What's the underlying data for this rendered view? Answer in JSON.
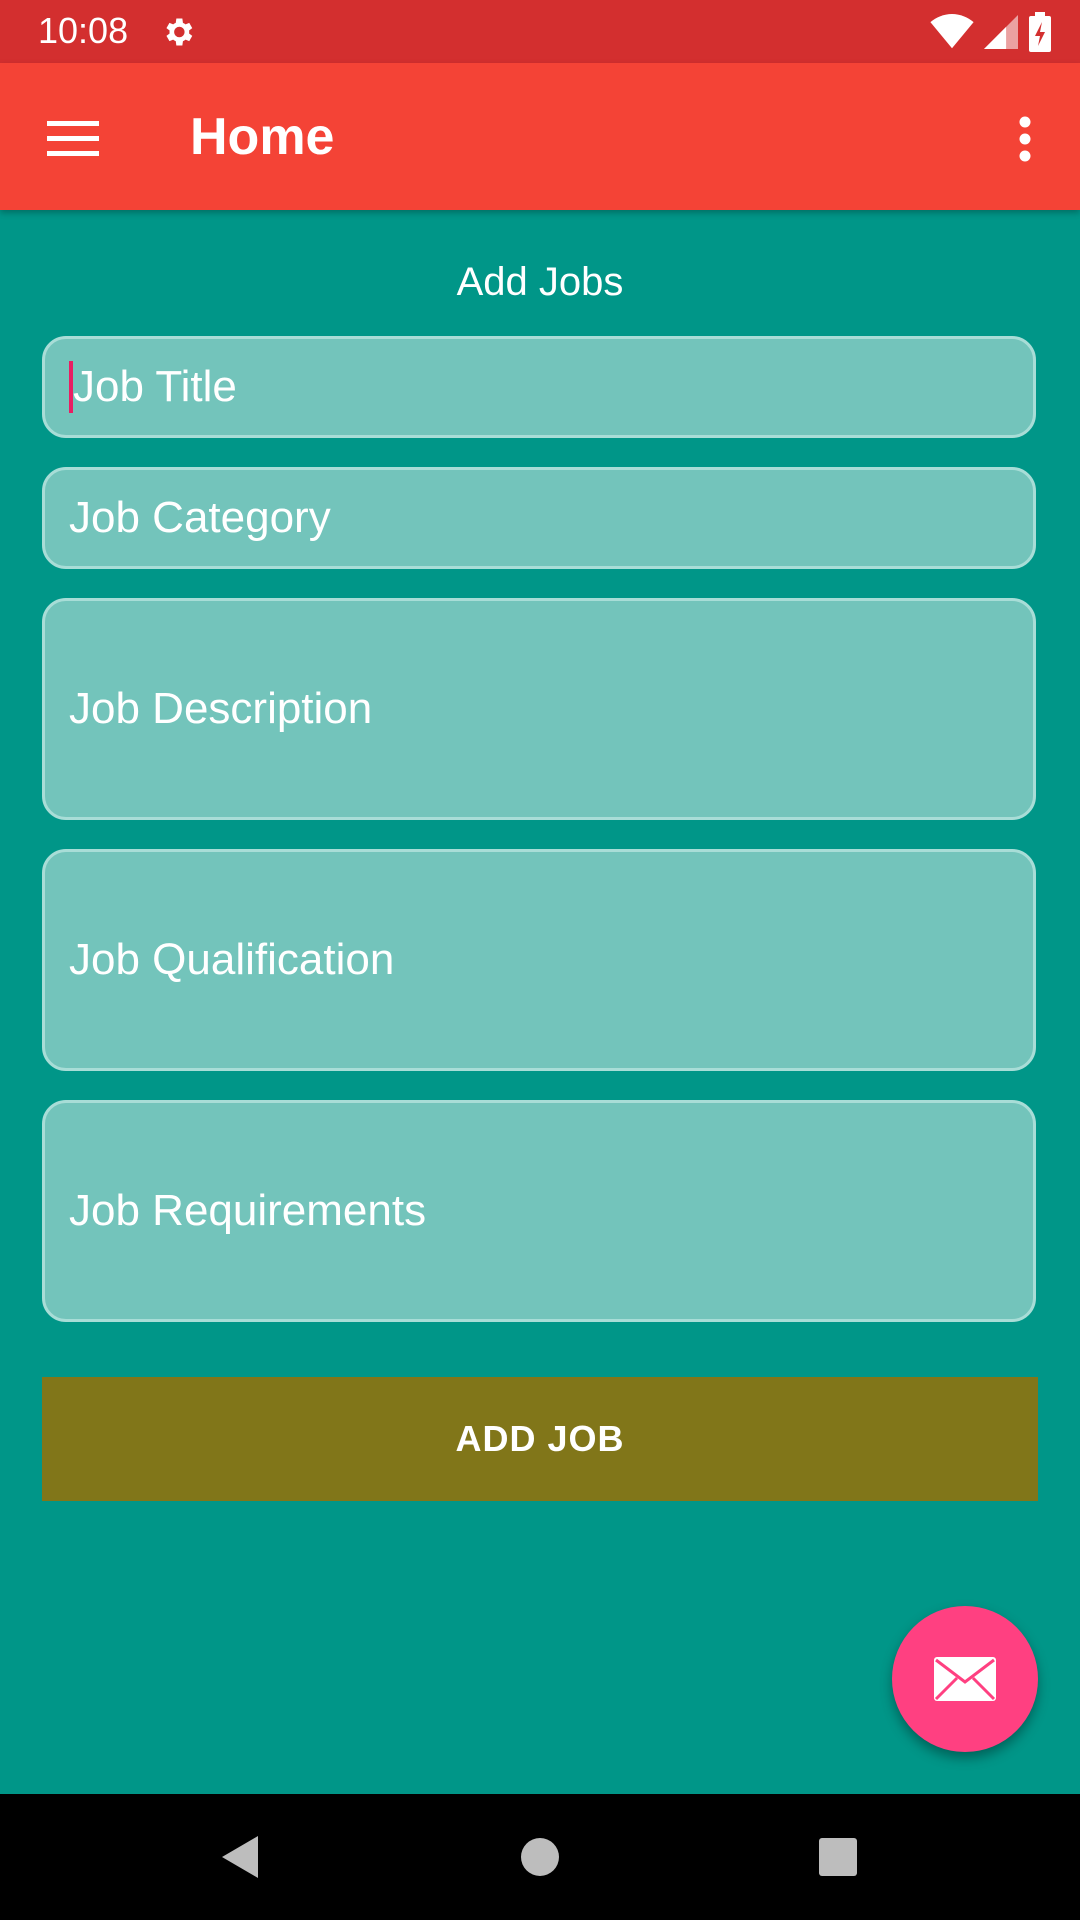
{
  "status_bar": {
    "time": "10:08",
    "icons": [
      "settings-icon",
      "wifi-icon",
      "signal-icon",
      "battery-charging-icon"
    ]
  },
  "app_bar": {
    "title": "Home",
    "menu_icon": "hamburger-menu-icon",
    "overflow_icon": "more-vert-icon"
  },
  "form": {
    "heading": "Add Jobs",
    "fields": [
      {
        "placeholder": "Job Title",
        "value": ""
      },
      {
        "placeholder": "Job Category",
        "value": ""
      },
      {
        "placeholder": "Job Description",
        "value": ""
      },
      {
        "placeholder": "Job Qualification",
        "value": ""
      },
      {
        "placeholder": "Job Requirements",
        "value": ""
      }
    ],
    "submit_label": "ADD JOB"
  },
  "fab": {
    "icon": "email-icon"
  },
  "nav_bar": {
    "icons": [
      "back-icon",
      "home-icon",
      "recents-icon"
    ]
  },
  "colors": {
    "status_bar": "#D32F2F",
    "app_bar": "#F44336",
    "background": "#009688",
    "field_fill": "#73C4BB",
    "button": "#817619",
    "fab": "#FF4081",
    "cursor": "#E91E63"
  }
}
